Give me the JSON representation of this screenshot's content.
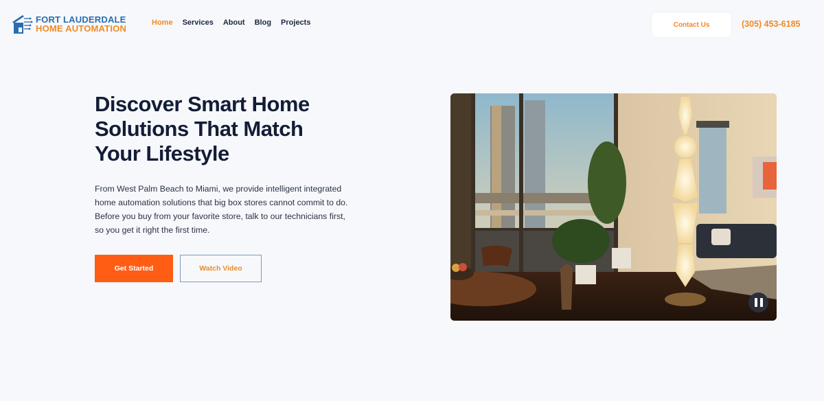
{
  "brand": {
    "line1": "FORT LAUDERDALE",
    "line2": "HOME AUTOMATION",
    "primary_color": "#2b6cb0",
    "accent_color": "#f08a24",
    "icon": "house-circuit-icon"
  },
  "nav": {
    "items": [
      {
        "label": "Home",
        "active": true
      },
      {
        "label": "Services",
        "active": false
      },
      {
        "label": "About",
        "active": false
      },
      {
        "label": "Blog",
        "active": false
      },
      {
        "label": "Projects",
        "active": false
      }
    ]
  },
  "header": {
    "contact_label": "Contact Us",
    "phone": "(305) 453-6185"
  },
  "hero": {
    "title": "Discover Smart Home Solutions That Match Your Lifestyle",
    "description": "From West Palm Beach to Miami, we provide intelligent integrated home automation solutions that big box stores cannot commit to do. Before you buy from your favorite store, talk to our technicians first, so you get it right the first time.",
    "primary_button": "Get Started",
    "secondary_button": "Watch Video",
    "primary_color": "#ff5d13"
  },
  "media": {
    "description": "Modern apartment interior with city skyline view, tall paper floor lamp, plants, dining table and sofa",
    "state": "playing",
    "control_icon": "pause-icon"
  }
}
